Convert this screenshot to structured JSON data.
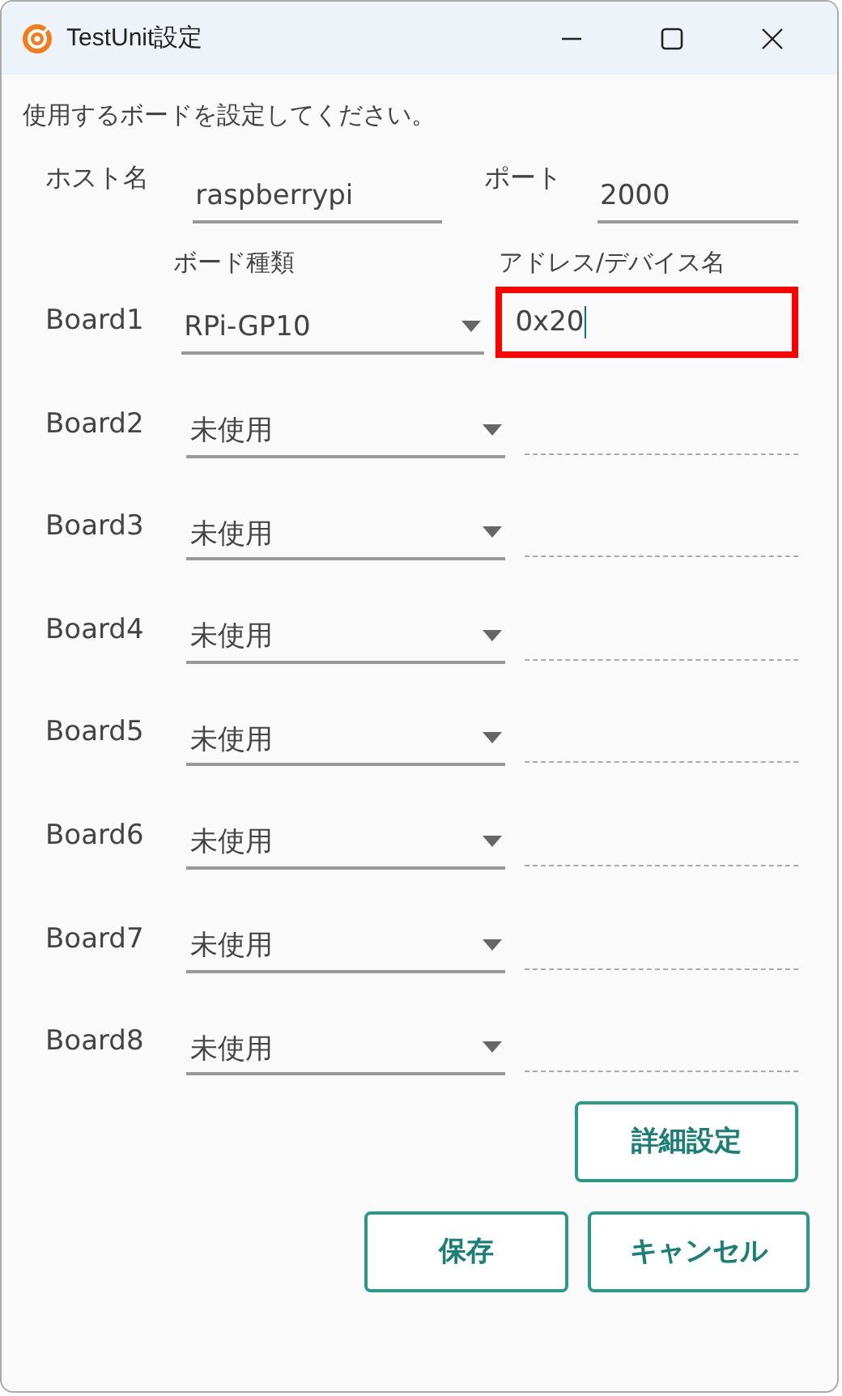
{
  "window": {
    "title": "TestUnit設定"
  },
  "instruction": "使用するボードを設定してください。",
  "host": {
    "label": "ホスト名",
    "value": "raspberrypi"
  },
  "port": {
    "label": "ポート",
    "value": "2000"
  },
  "columns": [
    "ボード種類",
    "アドレス/デバイス名"
  ],
  "boards": [
    {
      "label": "Board1",
      "type": "RPi-GP10",
      "address": "0x20",
      "address_disabled": false,
      "highlighted": true
    },
    {
      "label": "Board2",
      "type": "未使用",
      "address_disabled": true,
      "highlighted": false
    },
    {
      "label": "Board3",
      "type": "未使用",
      "address_disabled": true,
      "highlighted": false
    },
    {
      "label": "Board4",
      "type": "未使用",
      "address_disabled": true,
      "highlighted": false
    },
    {
      "label": "Board5",
      "type": "未使用",
      "address_disabled": true,
      "highlighted": false
    },
    {
      "label": "Board6",
      "type": "未使用",
      "address_disabled": true,
      "highlighted": false
    },
    {
      "label": "Board7",
      "type": "未使用",
      "address_disabled": true,
      "highlighted": false
    },
    {
      "label": "Board8",
      "type": "未使用",
      "address_disabled": true,
      "highlighted": false
    }
  ],
  "advanced_button": "詳細設定",
  "buttons": [
    "保存",
    "キャンセル"
  ]
}
